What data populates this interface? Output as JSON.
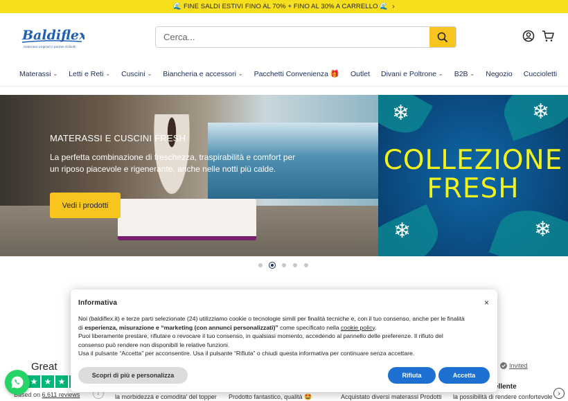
{
  "topbar": {
    "text": "🌊 FINE SALDI ESTIVI FINO AL 70% + FINO AL 30% A CARRELLO 🌊",
    "chevron": "›"
  },
  "header": {
    "logo_text": "Baldiflex",
    "logo_tagline": "materassi originali il portale di Baldi",
    "search_placeholder": "Cerca...",
    "icons": [
      "search-icon",
      "user-icon",
      "cart-icon"
    ]
  },
  "nav": {
    "items": [
      {
        "label": "Materassi",
        "caret": true
      },
      {
        "label": "Letti e Reti",
        "caret": true
      },
      {
        "label": "Cuscini",
        "caret": true
      },
      {
        "label": "Biancheria e accessori",
        "caret": true
      },
      {
        "label": "Pacchetti Convenienza 🎁",
        "caret": false
      },
      {
        "label": "Outlet",
        "caret": false
      },
      {
        "label": "Divani e Poltrone",
        "caret": true
      },
      {
        "label": "B2B",
        "caret": true
      },
      {
        "label": "Negozio",
        "caret": false
      },
      {
        "label": "Cuccioletti",
        "caret": false
      }
    ]
  },
  "hero": {
    "title": "MATERASSI E CUSCINI FRESH",
    "text": "La perfetta combinazione di freschezza, traspirabilità e comfort per un riposo piacevole e rigenerante, anche nelle notti più calde.",
    "button": "Vedi i prodotti",
    "promo_line1": "COLLEZIONE",
    "promo_line2": "FRESH"
  },
  "carousel": {
    "slides": 5,
    "active_index": 1
  },
  "reviews": {
    "rating_word": "Great",
    "based_prefix": "Based on",
    "based_count": "6,611 reviews",
    "invited": "Invited",
    "name_partial": "ellente",
    "snippets": [
      "la morbidezza e comodita' del topper",
      "Prodotto fantastico, qualità 🤩",
      "Acquistato diversi materassi Prodotti",
      "la possibilità di rendere confortevole"
    ]
  },
  "cookie": {
    "title": "Informativa",
    "close": "×",
    "p1_a": "Noi (baldiflex.it) e terze parti selezionate (24) utilizziamo cookie o tecnologie simili per finalità tecniche e, con il tuo consenso, anche per le finalità di ",
    "p1_b": "esperienza, misurazione e “marketing (con annunci personalizzati)”",
    "p1_c": " come specificato nella ",
    "p1_link": "cookie policy",
    "p1_d": ".",
    "p2": "Puoi liberamente prestare, rifiutare o revocare il tuo consenso, in qualsiasi momento, accedendo al pannello delle preferenze. Il rifiuto del consenso può rendere non disponibili le relative funzioni.",
    "p3": "Usa il pulsante “Accetta” per acconsentire. Usa il pulsante “Rifiuta” o chiudi questa informativa per continuare senza accettare.",
    "btn_more": "Scopri di più e personalizza",
    "btn_reject": "Rifiuta",
    "btn_accept": "Accetta"
  },
  "colors": {
    "accent_yellow": "#f7c51e",
    "topbar_yellow": "#f7df1e",
    "nav_text": "#1a2b5e",
    "cookie_blue": "#1d6fd2",
    "whatsapp_green": "#25d366"
  }
}
